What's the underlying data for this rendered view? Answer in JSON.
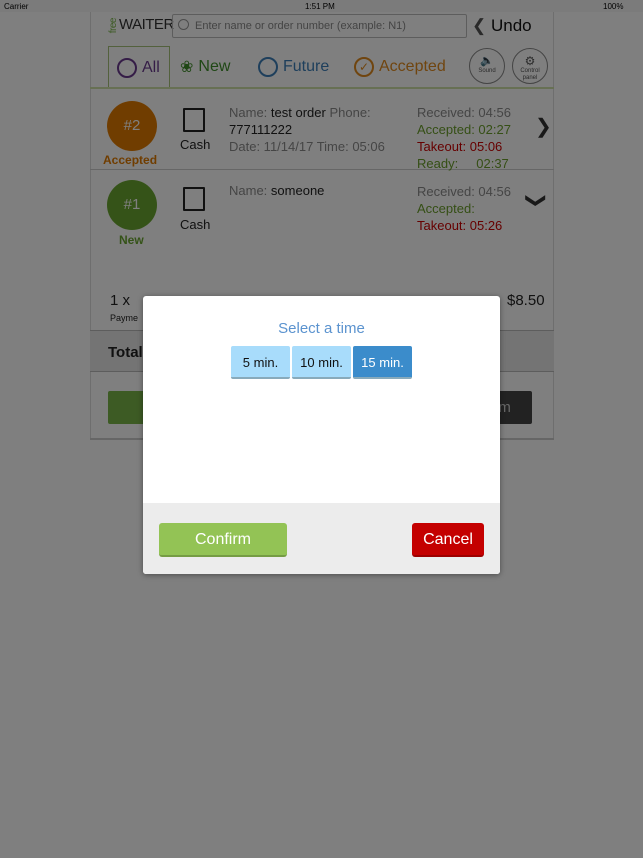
{
  "status_bar": {
    "carrier": "Carrier",
    "time": "1:51 PM",
    "battery": "100%"
  },
  "header": {
    "logo_free": "free",
    "logo_main": "WAITER",
    "search_placeholder": "Enter name or order number (example: N1)",
    "undo": "Undo"
  },
  "tabs": [
    {
      "label": "All",
      "color": "#6a3b8f"
    },
    {
      "label": "New",
      "color": "#3f8f2a"
    },
    {
      "label": "Future",
      "color": "#3d7fb8"
    },
    {
      "label": "Accepted",
      "color": "#e08a1e"
    }
  ],
  "controls": {
    "sound": "Sound",
    "control_panel": "Control panel"
  },
  "orders": [
    {
      "number": "#2",
      "status": "Accepted",
      "status_color": "#e07b00",
      "payment": "Cash",
      "name_label": "Name:",
      "name": "test order",
      "phone_label": "Phone:",
      "phone": "777111222",
      "date_line": "Date: 11/14/17 Time: 05:06",
      "received": "Received: 04:56",
      "accepted": "Accepted: 02:27",
      "takeout": "Takeout: 05:06",
      "ready": "Ready:     02:37"
    },
    {
      "number": "#1",
      "status": "New",
      "status_color": "#6aa630",
      "payment": "Cash",
      "name_label": "Name:",
      "name": "someone",
      "received": "Received: 04:56",
      "accepted": "Accepted:",
      "takeout": "Takeout: 05:26",
      "item_qty": "1 x",
      "item_price": "$8.50",
      "payment_label": "Payme"
    }
  ],
  "total_label": "Total",
  "action_right_fragment": "am",
  "modal": {
    "title": "Select a time",
    "options": [
      "5 min.",
      "10 min.",
      "15 min."
    ],
    "selected": "15 min.",
    "confirm": "Confirm",
    "cancel": "Cancel"
  }
}
